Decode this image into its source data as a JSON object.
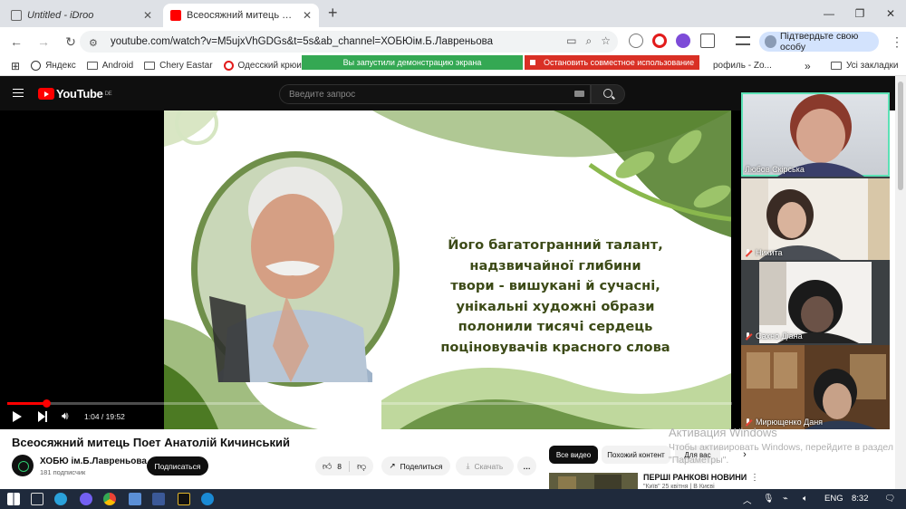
{
  "browser": {
    "tabs": [
      {
        "title": "Untitled - iDroo",
        "active": false
      },
      {
        "title": "Всеосяжний митець Поет Анатолій Кичинський",
        "active": true
      }
    ],
    "new_tab": "+",
    "window_controls": {
      "minimize": "—",
      "maximize": "❐",
      "close": "✕"
    },
    "url": "youtube.com/watch?v=M5ujxVhGDGs&t=5s&ab_channel=ХОБЮім.Б.Лавреньова",
    "profile_button": "Підтвердьте свою особу",
    "bookmarks": [
      "Яндекс",
      "Android",
      "Chery Eastar",
      "Одесский крюинг"
    ],
    "bookmarks_right_partial": "рофиль - Zo...",
    "bookmarks_more": "»",
    "all_bookmarks": "Усі закладки"
  },
  "screen_share": {
    "status": "Вы запустили демонстрацию экрана",
    "stop_label": "Остановить совместное использование"
  },
  "youtube": {
    "logo": "YouTube",
    "region": "DE",
    "search_placeholder": "Введите запрос",
    "slide_text": [
      "Його багатогранний талант,",
      "надзвичайної глибини",
      "твори - вишукані й сучасні,",
      "унікальні художні образи",
      "полонили тисячі сердець",
      "поцiновувачів красного слова"
    ],
    "player": {
      "current_time": "1:04",
      "duration": "19:52",
      "progress": 0.054
    },
    "video_title": "Всеосяжний митець Поет Анатолій Кичинський",
    "channel_name": "ХОБЮ ім.Б.Лавреньова",
    "subscribers": "181 подписчик",
    "subscribe_label": "Подписаться",
    "likes": "8",
    "share_label": "Поделиться",
    "download_label": "Скачать",
    "more_label": "…",
    "chips": [
      "Все видео",
      "Похожий контент",
      "Для вас"
    ],
    "recommendation": {
      "title": "ПЕРШІ РАНКОВІ НОВИНИ",
      "subtitle": "\"Київ\" 25 квітня | В Києві"
    }
  },
  "participants": [
    {
      "name": "Любов Скірська",
      "muted": false,
      "speaking": true
    },
    {
      "name": "Никита",
      "muted": true,
      "speaking": false
    },
    {
      "name": "Сахно Діана",
      "muted": true,
      "speaking": false
    },
    {
      "name": "Мирющенко Даня",
      "muted": true,
      "speaking": false
    }
  ],
  "windows_activation": {
    "title": "Активация Windows",
    "message": "Чтобы активировать Windows, перейдите в раздел \"Параметры\"."
  },
  "taskbar": {
    "language": "ENG",
    "time": "8:32"
  },
  "colors": {
    "youtube_red": "#ff0000",
    "share_green": "#34a853",
    "share_red": "#d93025",
    "speaker_outline": "#5ce1b5"
  }
}
